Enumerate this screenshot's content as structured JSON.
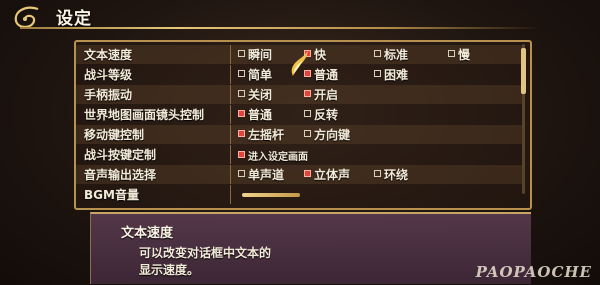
{
  "header": {
    "title": "设定"
  },
  "settings": [
    {
      "label": "文本速度",
      "options": [
        {
          "text": "瞬间",
          "selected": false
        },
        {
          "text": "快",
          "selected": true
        },
        {
          "text": "标准",
          "selected": false
        },
        {
          "text": "慢",
          "selected": false
        }
      ]
    },
    {
      "label": "战斗等级",
      "options": [
        {
          "text": "简单",
          "selected": false
        },
        {
          "text": "普通",
          "selected": true
        },
        {
          "text": "困难",
          "selected": false
        }
      ]
    },
    {
      "label": "手柄振动",
      "options": [
        {
          "text": "关闭",
          "selected": false
        },
        {
          "text": "开启",
          "selected": true
        }
      ]
    },
    {
      "label": "世界地图画面镜头控制",
      "options": [
        {
          "text": "普通",
          "selected": true
        },
        {
          "text": "反转",
          "selected": false
        }
      ]
    },
    {
      "label": "移动键控制",
      "options": [
        {
          "text": "左摇杆",
          "selected": true
        },
        {
          "text": "方向键",
          "selected": false
        }
      ]
    },
    {
      "label": "战斗按键定制",
      "options": [
        {
          "text": "进入设定画面",
          "selected": true
        }
      ]
    },
    {
      "label": "音声输出选择",
      "options": [
        {
          "text": "单声道",
          "selected": false
        },
        {
          "text": "立体声",
          "selected": true
        },
        {
          "text": "环绕",
          "selected": false
        }
      ]
    },
    {
      "label": "BGM音量",
      "options": []
    }
  ],
  "description": {
    "title": "文本速度",
    "line1": "可以改变对话框中文本的",
    "line2": "显示速度。"
  },
  "watermark": "PAOPAOCHE",
  "colors": {
    "accent_gold": "#e2c583",
    "selected_box": "#e0443a",
    "desc_bg": "#58394e"
  }
}
